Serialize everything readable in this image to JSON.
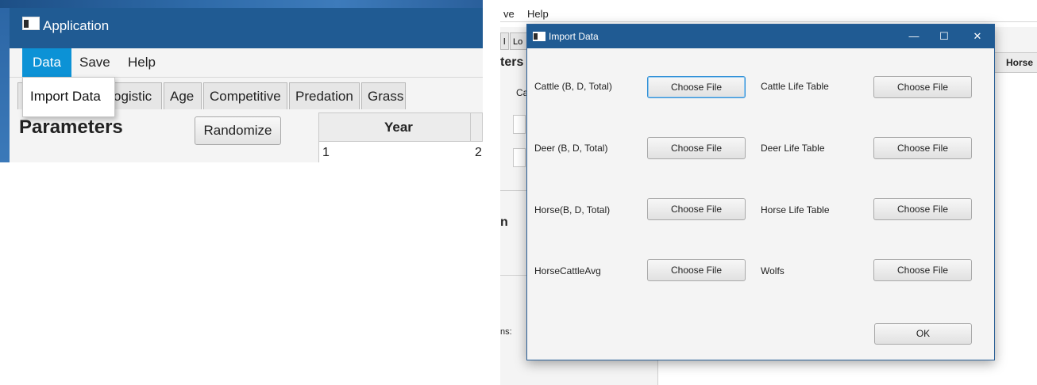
{
  "app": {
    "title": "Application",
    "menu": [
      "Data",
      "Save",
      "Help"
    ],
    "data_menu": {
      "items": [
        "Import Data"
      ]
    },
    "tabs": [
      "Logistic",
      "Age",
      "Competitive",
      "Predation",
      "Grass"
    ],
    "tab_visible_fragment": "ogistic",
    "parameters_title": "Parameters",
    "randomize_label": "Randomize",
    "table": {
      "column_header": "Year",
      "first_cell": "1",
      "second_cell_fragment": "2"
    }
  },
  "background_window": {
    "menu_fragments": [
      "ve",
      "Help"
    ],
    "tab_fragments": [
      "l",
      "Lo"
    ],
    "side_fragments": [
      "ters",
      "Ca",
      "n",
      "ns:"
    ],
    "table_header_fragment": "Horse"
  },
  "dialog": {
    "title": "Import Data",
    "controls": {
      "minimize": "—",
      "maximize": "☐",
      "close": "✕"
    },
    "choose_label": "Choose File",
    "rows": [
      {
        "left_label": "Cattle (B, D, Total)",
        "right_label": "Cattle Life Table"
      },
      {
        "left_label": "Deer (B, D, Total)",
        "right_label": "Deer Life Table"
      },
      {
        "left_label": "Horse(B, D, Total)",
        "right_label": "Horse Life Table"
      },
      {
        "left_label": "HorseCattleAvg",
        "right_label": "Wolfs"
      }
    ],
    "ok_label": "OK"
  },
  "colors": {
    "titlebar": "#205b93",
    "menu_active": "#0c92d6",
    "focus_border": "#2f8fd6",
    "window_bg": "#f4f4f4"
  },
  "icons": [
    "app-window-icon",
    "dialog-window-icon"
  ]
}
